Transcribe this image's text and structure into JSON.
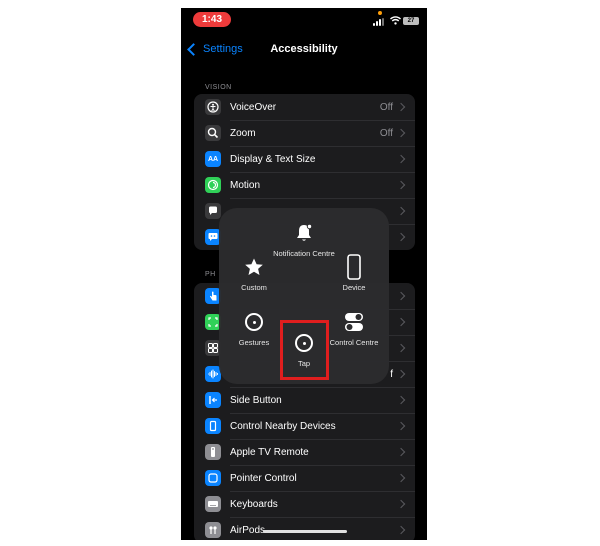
{
  "status_bar": {
    "time": "1:43",
    "battery": "27"
  },
  "nav": {
    "back_label": "Settings",
    "title": "Accessibility"
  },
  "sections": {
    "vision": {
      "header": "VISION",
      "items": [
        {
          "label": "VoiceOver",
          "value": "Off",
          "icon": "voiceover-icon",
          "color": "#3a3a3c"
        },
        {
          "label": "Zoom",
          "value": "Off",
          "icon": "zoom-icon",
          "color": "#3a3a3c"
        },
        {
          "label": "Display & Text Size",
          "value": "",
          "icon": "text-size-icon",
          "color": "#0a84ff",
          "glyph": "AA"
        },
        {
          "label": "Motion",
          "value": "",
          "icon": "motion-icon",
          "color": "#30d158"
        },
        {
          "label": "",
          "value": "",
          "icon": "spoken-content-icon",
          "color": "#3a3a3c"
        },
        {
          "label": "",
          "value": "",
          "icon": "audio-descriptions-icon",
          "color": "#0a84ff"
        }
      ]
    },
    "physical": {
      "header": "PH",
      "items": [
        {
          "label": "",
          "value": "",
          "icon": "touch-icon",
          "color": "#0a84ff"
        },
        {
          "label": "",
          "value": "",
          "icon": "face-id-icon",
          "color": "#30d158"
        },
        {
          "label": "",
          "value": "",
          "icon": "switch-control-icon",
          "color": "#3a3a3c"
        },
        {
          "label": "",
          "value": "",
          "icon": "voice-control-icon",
          "color": "#0a84ff",
          "trailing": "f"
        },
        {
          "label": "Side Button",
          "value": "",
          "icon": "side-button-icon",
          "color": "#0a84ff"
        },
        {
          "label": "Control Nearby Devices",
          "value": "",
          "icon": "nearby-devices-icon",
          "color": "#0a84ff"
        },
        {
          "label": "Apple TV Remote",
          "value": "",
          "icon": "remote-icon",
          "color": "#8e8e93"
        },
        {
          "label": "Pointer Control",
          "value": "",
          "icon": "pointer-icon",
          "color": "#0a84ff"
        },
        {
          "label": "Keyboards",
          "value": "",
          "icon": "keyboard-icon",
          "color": "#8e8e93"
        },
        {
          "label": "AirPods",
          "value": "",
          "icon": "airpods-icon",
          "color": "#8e8e93"
        }
      ]
    }
  },
  "assistive_touch_menu": {
    "notification_centre": "Notification Centre",
    "custom": "Custom",
    "device": "Device",
    "gestures": "Gestures",
    "control_centre": "Control Centre",
    "tap": "Tap"
  },
  "colors": {
    "highlight": "#e01e1e",
    "accent": "#0a84ff"
  }
}
